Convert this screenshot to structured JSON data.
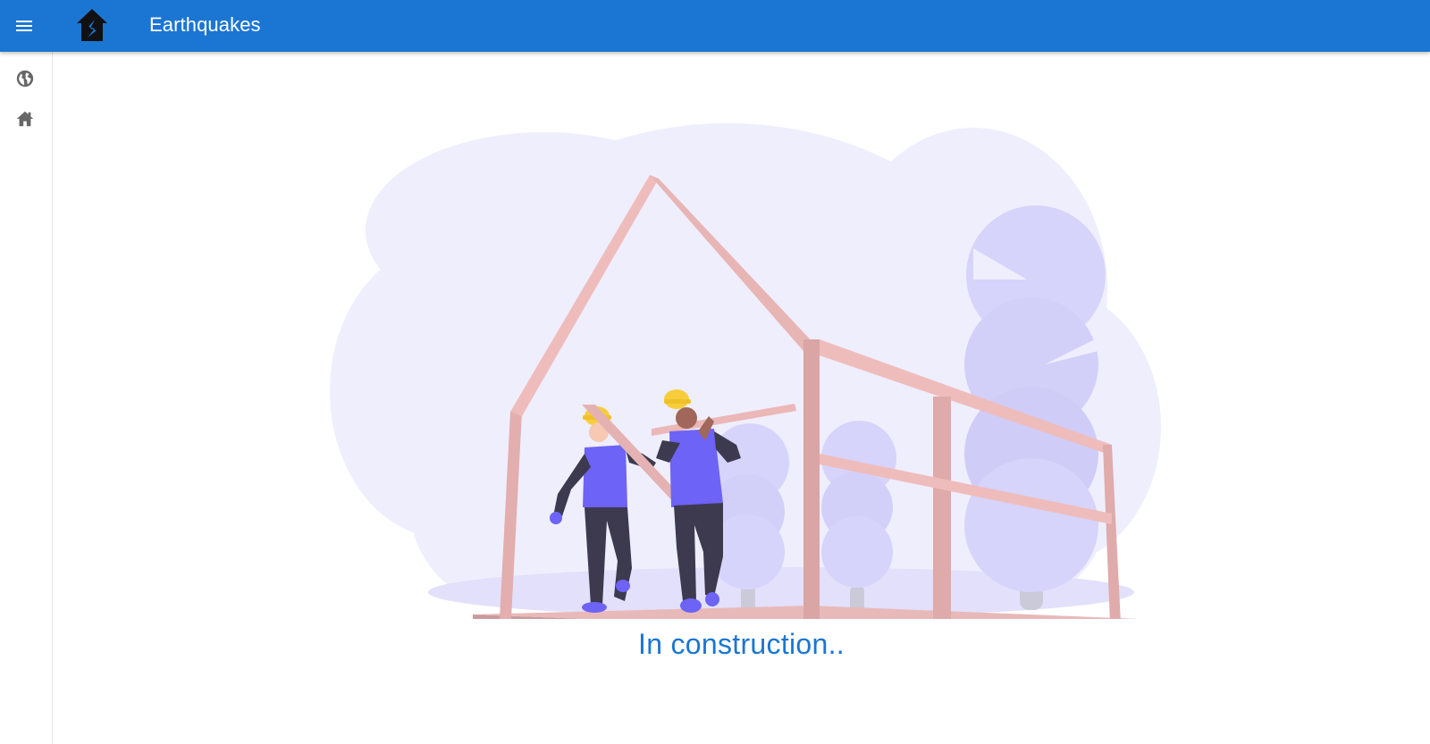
{
  "header": {
    "title": "Earthquakes",
    "background_color": "#1b76d3",
    "menu_icon": "hamburger-menu-icon",
    "logo_icon": "cracked-house-logo-icon"
  },
  "sidebar": {
    "items": [
      {
        "icon": "globe-icon"
      },
      {
        "icon": "home-icon"
      }
    ]
  },
  "main": {
    "status_text": "In construction..",
    "status_color": "#1b76d3",
    "illustration": "workers-building-house-frame-illustration"
  }
}
